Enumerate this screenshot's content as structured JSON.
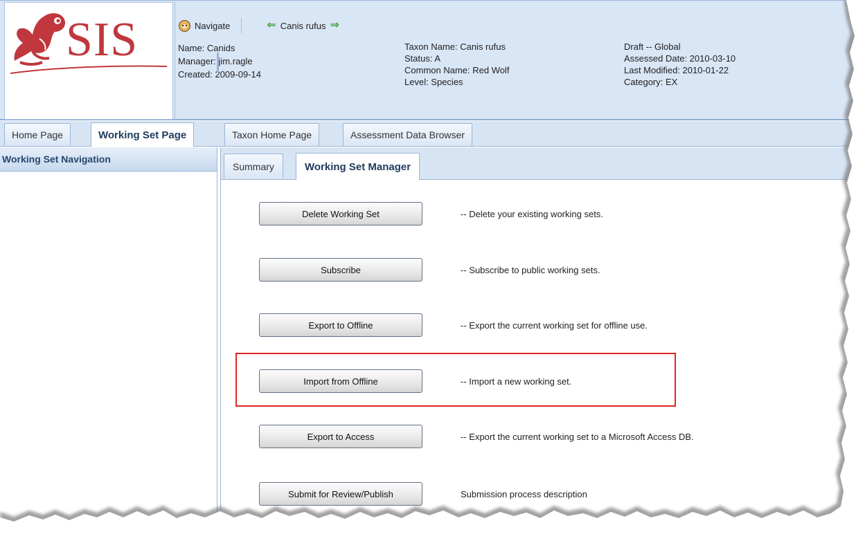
{
  "logo": {
    "text": "SIS"
  },
  "nav": {
    "navigate_label": "Navigate",
    "taxon_label": "Canis rufus",
    "back_icon": "arrow-left-icon",
    "forward_icon": "arrow-right-icon"
  },
  "working_set": {
    "name": "Name: Canids",
    "manager": "Manager: jim.ragle",
    "created": "Created: 2009-09-14"
  },
  "taxon": {
    "name": "Taxon Name: Canis rufus",
    "status": "Status: A",
    "common_name": "Common Name: Red Wolf",
    "level": "Level: Species"
  },
  "assessment": {
    "draft": "Draft -- Global",
    "assessed_date": "Assessed Date: 2010-03-10",
    "last_modified": "Last Modified: 2010-01-22",
    "category": "Category: EX"
  },
  "main_tabs": [
    {
      "label": "Home Page",
      "active": false
    },
    {
      "label": "Working Set Page",
      "active": true
    },
    {
      "label": "Taxon Home Page",
      "active": false
    },
    {
      "label": "Assessment Data Browser",
      "active": false
    }
  ],
  "left_panel": {
    "title": "Working Set Navigation"
  },
  "sub_tabs": [
    {
      "label": "Summary",
      "active": false
    },
    {
      "label": "Working Set Manager",
      "active": true
    }
  ],
  "actions": [
    {
      "button": "Delete Working Set",
      "description": "-- Delete your existing working sets."
    },
    {
      "button": "Subscribe",
      "description": "-- Subscribe to public working sets."
    },
    {
      "button": "Export to Offline",
      "description": "-- Export the current working set for offline use."
    },
    {
      "button": "Import from Offline",
      "description": "-- Import a new working set."
    },
    {
      "button": "Export to Access",
      "description": "-- Export the current working set to a Microsoft Access DB."
    },
    {
      "button": "Submit for Review/Publish",
      "description": "Submission process description"
    }
  ],
  "colors": {
    "logo_red": "#c0373d",
    "header_bg": "#d9e6f6",
    "tab_border": "#9ab4d6",
    "highlight_red": "#e0241f",
    "arrow_green": "#3aa23a"
  }
}
